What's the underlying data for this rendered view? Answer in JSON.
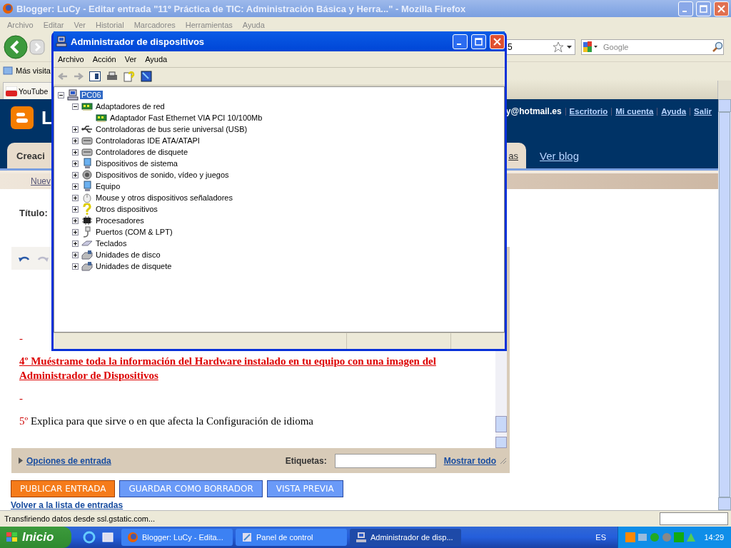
{
  "browser": {
    "title": "Blogger: LuCy - Editar entrada \"11º Práctica de TIC: Administración Básica y Herra...\" - Mozilla Firefox",
    "menu": [
      "Archivo",
      "Editar",
      "Ver",
      "Historial",
      "Marcadores",
      "Herramientas",
      "Ayuda"
    ],
    "url_fragment": "5",
    "search": {
      "placeholder": "Google"
    },
    "bookmarks": [
      "Más visita"
    ],
    "tabs": [
      {
        "label": "YouTube",
        "selected": true
      }
    ],
    "page": {
      "blog_title": "L",
      "account": "y@hotmail.es",
      "links": [
        "Escritorio",
        "Mi cuenta",
        "Ayuda",
        "Salir"
      ],
      "tabs": [
        {
          "label": "Creaci",
          "selected": true
        },
        {
          "label": "as",
          "selected": false
        },
        {
          "label": "Ver blog",
          "selected": false
        }
      ],
      "subnav": "Nuev",
      "title_label": "Título:",
      "editor": {
        "paragraphs": [
          {
            "kind": "dash",
            "text": "-"
          },
          {
            "kind": "heading",
            "text": "4º Muéstrame toda la información del Hardware instalado en tu equipo con una imagen del Administrador de Dispositivos"
          },
          {
            "kind": "dash",
            "text": "-"
          },
          {
            "kind": "numbered",
            "number": "5º",
            "text": "Explica para que sirve o en que afecta la Configuración de idioma"
          }
        ],
        "options_link": "Opciones de entrada",
        "tags_label": "Etiquetas:",
        "show_all": "Mostrar todo"
      },
      "buttons": [
        {
          "label": "PUBLICAR ENTRADA",
          "kind": "primary"
        },
        {
          "label": "GUARDAR COMO BORRADOR",
          "kind": "secondary"
        },
        {
          "label": "VISTA PREVIA",
          "kind": "secondary"
        }
      ],
      "back_link": "Volver a la lista de entradas"
    },
    "status": "Transfiriendo datos desde ssl.gstatic.com..."
  },
  "device_manager": {
    "title": "Administrador de dispositivos",
    "menu": [
      "Archivo",
      "Acción",
      "Ver",
      "Ayuda"
    ],
    "tree": {
      "label": "PC06",
      "kind": "computer",
      "expanded": true,
      "selected": true,
      "children": [
        {
          "label": "Adaptadores de red",
          "kind": "network",
          "expanded": true,
          "selected": false,
          "children": [
            {
              "label": "Adaptador Fast Ethernet VIA PCI 10/100Mb",
              "kind": "network",
              "selected": false
            }
          ]
        },
        {
          "label": "Controladoras de bus serie universal (USB)",
          "kind": "usb",
          "expanded": false,
          "selected": false
        },
        {
          "label": "Controladoras IDE ATA/ATAPI",
          "kind": "drive",
          "expanded": false,
          "selected": false
        },
        {
          "label": "Controladores de disquete",
          "kind": "drive",
          "expanded": false,
          "selected": false
        },
        {
          "label": "Dispositivos de sistema",
          "kind": "monitor",
          "expanded": false,
          "selected": false
        },
        {
          "label": "Dispositivos de sonido, vídeo y juegos",
          "kind": "speaker",
          "expanded": false,
          "selected": false
        },
        {
          "label": "Equipo",
          "kind": "monitor",
          "expanded": false,
          "selected": false
        },
        {
          "label": "Mouse y otros dispositivos señaladores",
          "kind": "mouse",
          "expanded": false,
          "selected": false
        },
        {
          "label": "Otros dispositivos",
          "kind": "question",
          "expanded": false,
          "selected": false
        },
        {
          "label": "Procesadores",
          "kind": "chip",
          "expanded": false,
          "selected": false
        },
        {
          "label": "Puertos (COM & LPT)",
          "kind": "plug",
          "expanded": false,
          "selected": false
        },
        {
          "label": "Teclados",
          "kind": "keyboard",
          "expanded": false,
          "selected": false
        },
        {
          "label": "Unidades de disco",
          "kind": "disk",
          "expanded": false,
          "selected": false
        },
        {
          "label": "Unidades de disquete",
          "kind": "disk",
          "expanded": false,
          "selected": false
        }
      ]
    }
  },
  "taskbar": {
    "start": "Inicio",
    "tasks": [
      {
        "label": "Blogger: LuCy - Edita...",
        "kind": "firefox",
        "selected": false
      },
      {
        "label": "Panel de control",
        "kind": "panel",
        "selected": false
      },
      {
        "label": "Administrador de disp...",
        "kind": "computer",
        "selected": true
      }
    ],
    "language": "ES",
    "clock": "14:29"
  }
}
